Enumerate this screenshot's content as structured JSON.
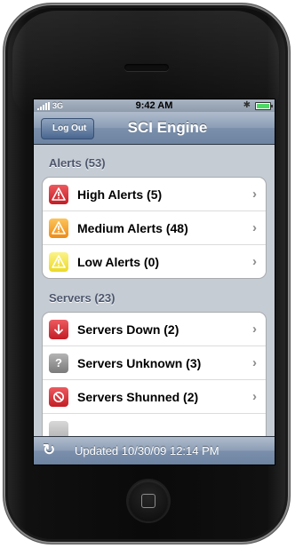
{
  "status": {
    "carrier": "3G",
    "time": "9:42 AM"
  },
  "nav": {
    "back_label": "Log Out",
    "title": "SCI Engine"
  },
  "sections": [
    {
      "header": "Alerts (53)",
      "rows": [
        {
          "label": "High Alerts (5)",
          "icon": "warning-red-icon",
          "color": "#d9262e"
        },
        {
          "label": "Medium Alerts (48)",
          "icon": "warning-orange-icon",
          "color": "#f5a623"
        },
        {
          "label": "Low Alerts (0)",
          "icon": "warning-yellow-icon",
          "color": "#f3e63c"
        }
      ]
    },
    {
      "header": "Servers (23)",
      "rows": [
        {
          "label": "Servers Down (2)",
          "icon": "arrow-down-icon",
          "color": "#d9262e"
        },
        {
          "label": "Servers Unknown (3)",
          "icon": "question-icon",
          "color": "#8e8e8e"
        },
        {
          "label": "Servers Shunned (2)",
          "icon": "prohibited-icon",
          "color": "#d9262e"
        }
      ]
    }
  ],
  "toolbar": {
    "updated": "Updated 10/30/09 12:14 PM",
    "refresh_icon": "refresh-icon"
  }
}
